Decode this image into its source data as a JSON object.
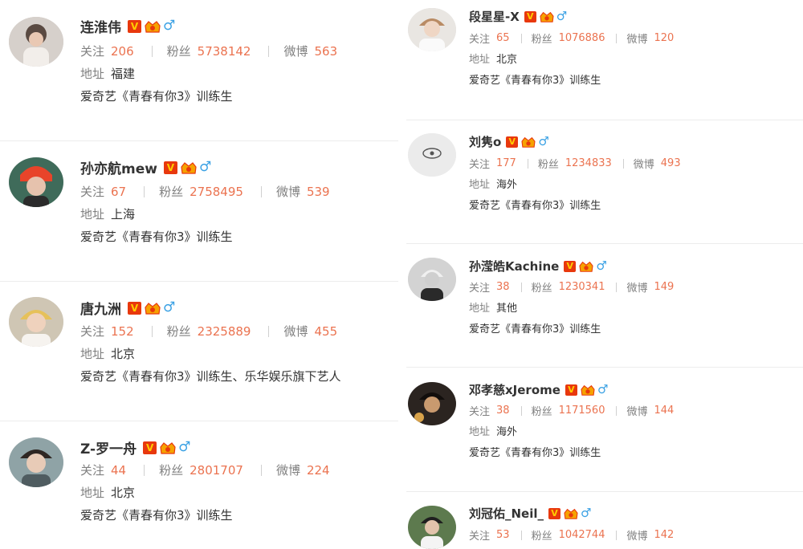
{
  "labels": {
    "follow": "关注",
    "fans": "粉丝",
    "weibo": "微博",
    "address": "地址",
    "verified_badge": "V",
    "gender_symbol": "♂"
  },
  "colors": {
    "number": "#eb7350",
    "label": "#808080",
    "verified_bg": "#e8380d",
    "gender": "#3aa1e4"
  },
  "left_column": [
    {
      "name": "连淮伟",
      "follow": "206",
      "fans": "5738142",
      "weibo": "563",
      "address": "福建",
      "desc": "爱奇艺《青春有你3》训练生"
    },
    {
      "name": "孙亦航mew",
      "follow": "67",
      "fans": "2758495",
      "weibo": "539",
      "address": "上海",
      "desc": "爱奇艺《青春有你3》训练生"
    },
    {
      "name": "唐九洲",
      "follow": "152",
      "fans": "2325889",
      "weibo": "455",
      "address": "北京",
      "desc": "爱奇艺《青春有你3》训练生、乐华娱乐旗下艺人"
    },
    {
      "name": "Z-罗一舟",
      "follow": "44",
      "fans": "2801707",
      "weibo": "224",
      "address": "北京",
      "desc": "爱奇艺《青春有你3》训练生"
    }
  ],
  "right_column": [
    {
      "name": "段星星-X",
      "follow": "65",
      "fans": "1076886",
      "weibo": "120",
      "address": "北京",
      "desc": "爱奇艺《青春有你3》训练生"
    },
    {
      "name": "刘隽o",
      "follow": "177",
      "fans": "1234833",
      "weibo": "493",
      "address": "海外",
      "desc": "爱奇艺《青春有你3》训练生"
    },
    {
      "name": "孙滢皓Kachine",
      "follow": "38",
      "fans": "1230341",
      "weibo": "149",
      "address": "其他",
      "desc": "爱奇艺《青春有你3》训练生"
    },
    {
      "name": "邓孝慈xJerome",
      "follow": "38",
      "fans": "1171560",
      "weibo": "144",
      "address": "海外",
      "desc": "爱奇艺《青春有你3》训练生"
    },
    {
      "name": "刘冠佑_Neil_",
      "follow": "53",
      "fans": "1042744",
      "weibo": "142"
    }
  ]
}
